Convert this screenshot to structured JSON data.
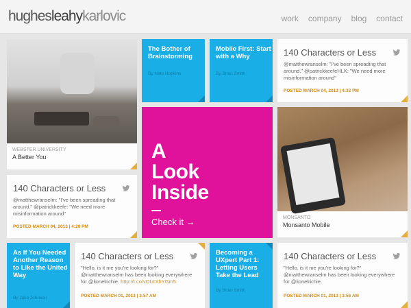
{
  "header": {
    "logo": {
      "part1": "hughes",
      "part2": "leahy",
      "part3": "karlovic"
    },
    "nav": [
      "work",
      "company",
      "blog",
      "contact"
    ]
  },
  "tiles": {
    "webster": {
      "client": "WEBSTER UNIVERSITY",
      "title": "A Better You"
    },
    "brainstorm": {
      "title": "The Bother of Brainstorming",
      "byline": "By Nate Hopkins"
    },
    "mobile_first": {
      "title": "Mobile First: Start with a Why",
      "byline": "By Brian Smith"
    },
    "tweet1": {
      "title": "140 Characters or Less",
      "body": "@matthewranselm: \"I've been spreading that around.\" @patrickkeefeHLK: \"We need more misinformation around\"",
      "meta": "POSTED MARCH 04, 2013 | 4:32 PM"
    },
    "hero": {
      "line1": "A",
      "line2": "Look",
      "line3": "Inside",
      "cta": "Check it →"
    },
    "tweet2": {
      "title": "140 Characters or Less",
      "body": "@matthewranselm: \"I've been spreading that around.\" @patrickkeefe: \"We need more misinformation around\"",
      "meta": "POSTED MARCH 04, 2013 | 4:20 PM"
    },
    "monsanto": {
      "client": "MONSANTO",
      "title": "Monsanto Mobile"
    },
    "needed": {
      "title": "As If You Needed Another Reason to Like the United Way",
      "byline": "By Jake Johnson"
    },
    "tweet3": {
      "title": "140 Characters or Less",
      "body": "\"Hello, is it me you're looking for?\" @matthewranselm has been looking everywhere for @lionelrichie.",
      "link": "http://t.co/vOUrXhYGm5",
      "meta": "POSTED MARCH 01, 2013 | 3:57 AM"
    },
    "uxpert": {
      "title": "Becoming a UXpert Part 1: Letting Users Take the Lead",
      "byline": "By Brian Smith"
    },
    "tweet4": {
      "title": "140 Characters or Less",
      "body": "\"Hello, is it me you're looking for?\" @matthewranselm has been looking everywhere for @lionelrichie.",
      "meta": "POSTED MARCH 01, 2013 | 3:56 AM"
    }
  },
  "colors": {
    "accent_blue": "#19aee6",
    "accent_magenta": "#e0119a",
    "accent_orange": "#d48a10"
  },
  "icons": {
    "tweet": "twitter-bird-icon",
    "corner": "folded-corner-icon"
  }
}
